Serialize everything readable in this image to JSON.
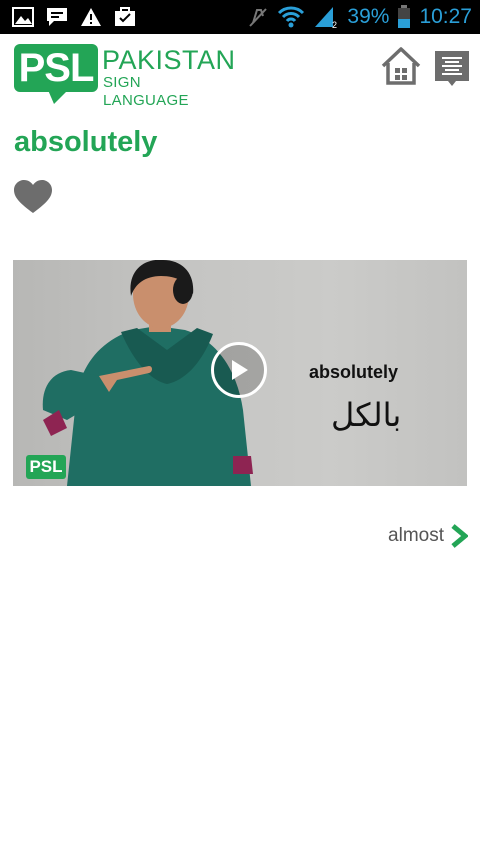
{
  "status_bar": {
    "icons_left": [
      "gallery-icon",
      "message-icon",
      "warning-icon",
      "briefcase-icon"
    ],
    "icons_right": [
      "vibrate-off-icon",
      "wifi-icon",
      "signal-icon",
      "battery-icon"
    ],
    "battery": "39%",
    "time": "10:27"
  },
  "header": {
    "logo_badge": "PSL",
    "logo_title": "PAKISTAN",
    "logo_subtitle": "SIGN LANGUAGE",
    "home_icon": "home-icon",
    "menu_icon": "list-icon"
  },
  "word": {
    "title": "absolutely",
    "favorite_icon": "heart-icon"
  },
  "video": {
    "caption_word": "absolutely",
    "caption_urdu": "بالکل",
    "watermark": "PSL",
    "play_icon": "play-icon"
  },
  "next": {
    "label": "almost",
    "icon": "chevron-right-icon"
  },
  "colors": {
    "brand_green": "#23a556",
    "status_blue": "#2a9fd8",
    "icon_gray": "#6d6d6d"
  }
}
